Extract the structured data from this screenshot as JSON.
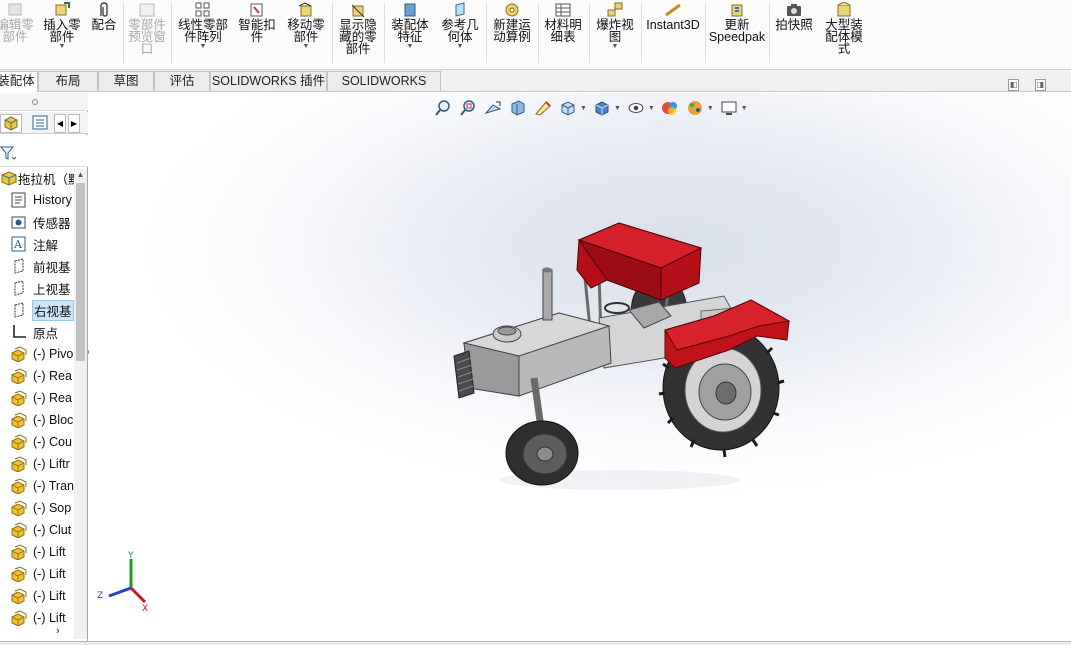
{
  "ribbon": {
    "buttons": [
      {
        "id": "edit-part",
        "label": "编辑零\n部件",
        "enabled": false,
        "dropdown": false
      },
      {
        "id": "insert-part",
        "label": "插入零\n部件",
        "enabled": true,
        "dropdown": true
      },
      {
        "id": "mate",
        "label": "配合",
        "enabled": true,
        "dropdown": false
      },
      {
        "id": "part-preview",
        "label": "零部件\n预览窗\n口",
        "enabled": false,
        "dropdown": false
      },
      {
        "id": "linear-pattern",
        "label": "线性零部\n件阵列",
        "enabled": true,
        "dropdown": true
      },
      {
        "id": "smart-fastener",
        "label": "智能扣\n件",
        "enabled": true,
        "dropdown": false
      },
      {
        "id": "move-part",
        "label": "移动零\n部件",
        "enabled": true,
        "dropdown": true
      },
      {
        "id": "show-hidden",
        "label": "显示隐\n藏的零\n部件",
        "enabled": true,
        "dropdown": false
      },
      {
        "id": "assembly-feature",
        "label": "装配体\n特征",
        "enabled": true,
        "dropdown": true
      },
      {
        "id": "ref-geometry",
        "label": "参考几\n何体",
        "enabled": true,
        "dropdown": true
      },
      {
        "id": "new-motion",
        "label": "新建运\n动算例",
        "enabled": true,
        "dropdown": false
      },
      {
        "id": "bom",
        "label": "材料明\n细表",
        "enabled": true,
        "dropdown": false
      },
      {
        "id": "exploded-view",
        "label": "爆炸视\n图",
        "enabled": true,
        "dropdown": true
      },
      {
        "id": "instant3d",
        "label": "Instant3D",
        "enabled": true,
        "dropdown": false
      },
      {
        "id": "update-speedpak",
        "label": "更新\nSpeedpak",
        "enabled": true,
        "dropdown": false
      },
      {
        "id": "snapshot",
        "label": "拍快照",
        "enabled": true,
        "dropdown": false
      },
      {
        "id": "large-assembly",
        "label": "大型装\n配体模\n式",
        "enabled": true,
        "dropdown": false
      }
    ]
  },
  "tabs": [
    "装配体",
    "布局",
    "草图",
    "评估",
    "SOLIDWORKS 插件",
    "SOLIDWORKS MBD"
  ],
  "tabs_active": 0,
  "tree": {
    "root": "拖拉机（默",
    "items": [
      {
        "icon": "history-icon",
        "label": "History"
      },
      {
        "icon": "sensor-icon",
        "label": "传感器"
      },
      {
        "icon": "annotation-icon",
        "label": "注解"
      },
      {
        "icon": "plane-icon",
        "label": "前视基"
      },
      {
        "icon": "plane-icon",
        "label": "上视基"
      },
      {
        "icon": "plane-icon",
        "label": "右视基",
        "selected": true
      },
      {
        "icon": "origin-icon",
        "label": "原点"
      },
      {
        "icon": "part-icon",
        "label": "(-) Pivo"
      },
      {
        "icon": "part-icon",
        "label": "(-) Rea"
      },
      {
        "icon": "part-icon",
        "label": "(-) Rea"
      },
      {
        "icon": "part-icon",
        "label": "(-) Bloc"
      },
      {
        "icon": "part-icon",
        "label": "(-) Cou"
      },
      {
        "icon": "part-icon",
        "label": "(-) Liftr"
      },
      {
        "icon": "part-icon",
        "label": "(-) Tran"
      },
      {
        "icon": "part-icon",
        "label": "(-) Sop"
      },
      {
        "icon": "part-icon",
        "label": "(-) Clut"
      },
      {
        "icon": "part-icon",
        "label": "(-) Lift"
      },
      {
        "icon": "part-icon",
        "label": "(-) Lift"
      },
      {
        "icon": "part-icon",
        "label": "(-) Lift"
      },
      {
        "icon": "part-icon",
        "label": "(-) Lift"
      }
    ]
  },
  "hud_icons": [
    "zoom-to-fit-icon",
    "zoom-area-icon",
    "previous-view-icon",
    "section-view-icon",
    "dynamic-annotation-icon",
    "view-orientation-icon",
    "display-style-icon",
    "hide-show-icon",
    "edit-appearance-icon",
    "apply-scene-icon",
    "view-settings-icon"
  ],
  "triad": {
    "x": "X",
    "y": "Y",
    "z": "Z"
  },
  "colors": {
    "accent_red": "#c0121a",
    "body_gray": "#b9b9bb",
    "tire_dark": "#3a3a3a",
    "selection": "#cde6f7"
  }
}
